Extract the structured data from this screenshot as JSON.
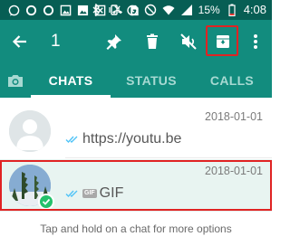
{
  "status_bar": {
    "battery_percent": "15%",
    "time": "4:08",
    "left_icons": [
      "whatsapp-icon",
      "circle-icon",
      "circle-icon",
      "image-icon",
      "picture-icon",
      "crossed-box-icon",
      "missed-call-icon",
      "sim-icon"
    ],
    "right_icons": [
      "bluetooth-icon",
      "vibrate-icon",
      "alarm-icon",
      "do-not-disturb-icon",
      "wifi-icon",
      "signal-icon",
      "battery-icon"
    ]
  },
  "toolbar": {
    "selected_count": "1",
    "actions": [
      "back-icon",
      "pin-icon",
      "delete-icon",
      "mute-icon",
      "archive-icon",
      "more-icon"
    ]
  },
  "tabs": {
    "camera": "camera-icon",
    "items": [
      {
        "label": "CHATS",
        "active": true
      },
      {
        "label": "STATUS",
        "active": false
      },
      {
        "label": "CALLS",
        "active": false
      }
    ]
  },
  "chats": [
    {
      "name": "",
      "date": "2018-01-01",
      "preview": "https://youtu.be",
      "ticks": "double-tick-icon"
    },
    {
      "name": "",
      "date": "2018-01-01",
      "preview": "GIF",
      "badge": "GIF",
      "ticks": "double-tick-icon",
      "selected": true
    }
  ],
  "hint": "Tap and hold on a chat for more options",
  "colors": {
    "status_bar": "#075e54",
    "toolbar": "#128c7e",
    "selected_row": "#e8f4f1",
    "highlight": "#e02323",
    "check": "#24c16b",
    "tick": "#4fc3f7"
  }
}
